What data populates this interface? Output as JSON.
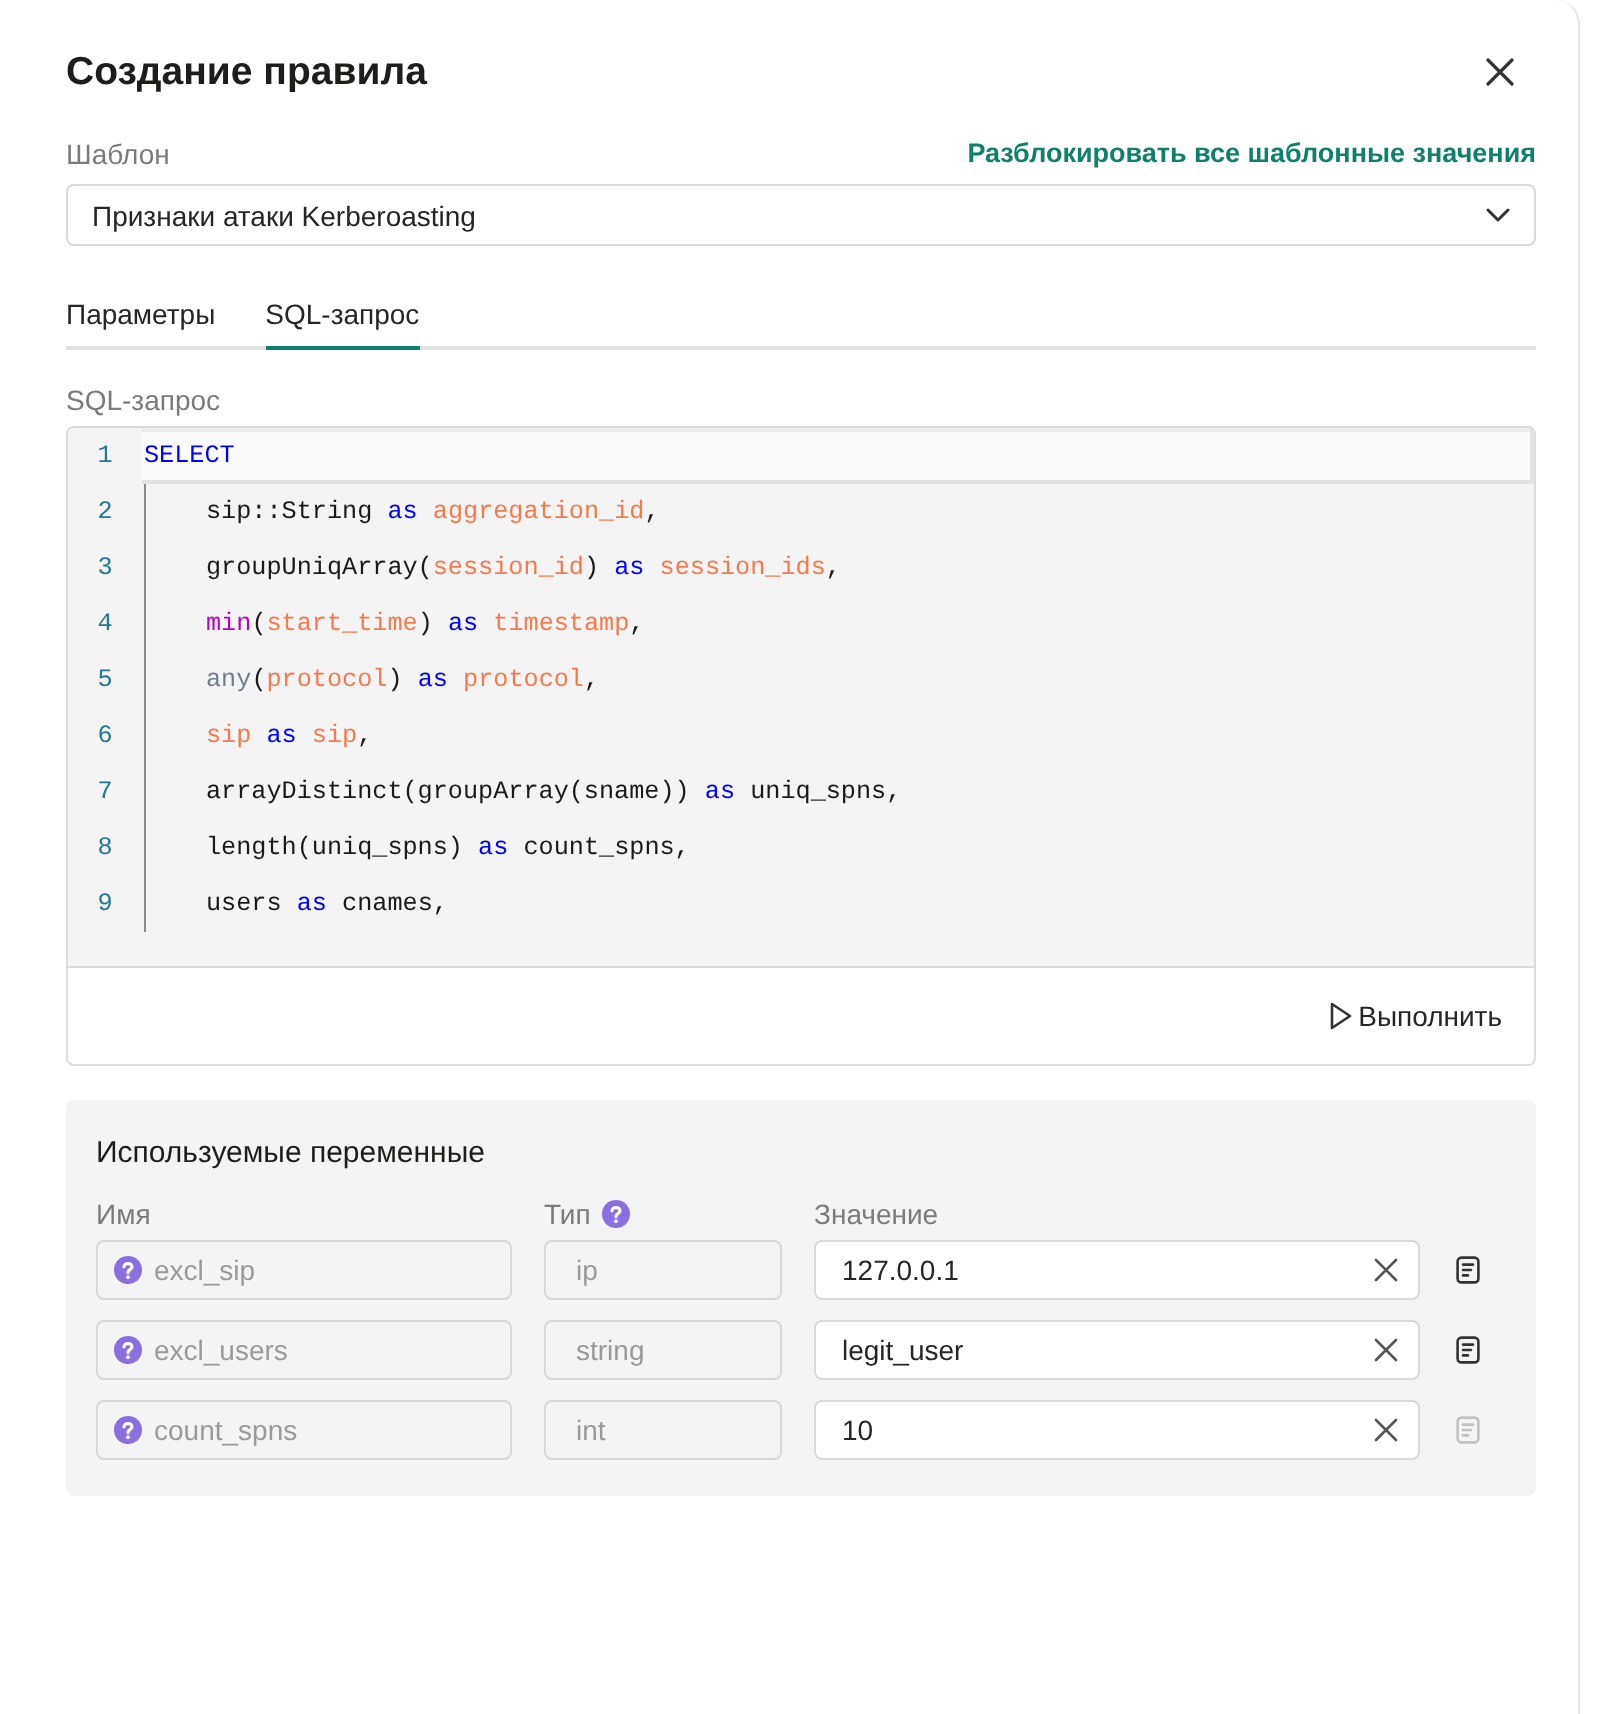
{
  "dialog": {
    "title": "Создание правила"
  },
  "template": {
    "label": "Шаблон",
    "unlock_link": "Разблокировать все шаблонные значения",
    "value": "Признаки атаки Kerberoasting"
  },
  "tabs": [
    {
      "label": "Параметры",
      "selected": false
    },
    {
      "label": "SQL-запрос",
      "selected": true
    }
  ],
  "sql_editor": {
    "label": "SQL-запрос",
    "lines": [
      {
        "number": "1",
        "active": true,
        "tokens": [
          {
            "kind": "keyword",
            "text": "SELECT"
          }
        ],
        "children": [
          {
            "number": "2",
            "active": false,
            "tokens": [
              {
                "kind": "plain",
                "text": "sip::String "
              },
              {
                "kind": "keyword",
                "text": "as "
              },
              {
                "kind": "identifier",
                "text": "aggregation_id"
              },
              {
                "kind": "plain",
                "text": ","
              }
            ]
          },
          {
            "number": "3",
            "active": false,
            "tokens": [
              {
                "kind": "plain",
                "text": "groupUniqArray("
              },
              {
                "kind": "identifier",
                "text": "session_id"
              },
              {
                "kind": "plain",
                "text": ") "
              },
              {
                "kind": "keyword",
                "text": "as "
              },
              {
                "kind": "identifier",
                "text": "session_ids"
              },
              {
                "kind": "plain",
                "text": ","
              }
            ]
          },
          {
            "number": "4",
            "active": false,
            "tokens": [
              {
                "kind": "function",
                "text": "min"
              },
              {
                "kind": "plain",
                "text": "("
              },
              {
                "kind": "identifier",
                "text": "start_time"
              },
              {
                "kind": "plain",
                "text": ") "
              },
              {
                "kind": "keyword",
                "text": "as "
              },
              {
                "kind": "identifier",
                "text": "timestamp"
              },
              {
                "kind": "plain",
                "text": ","
              }
            ]
          },
          {
            "number": "5",
            "active": false,
            "tokens": [
              {
                "kind": "builtin",
                "text": "any"
              },
              {
                "kind": "plain",
                "text": "("
              },
              {
                "kind": "identifier",
                "text": "protocol"
              },
              {
                "kind": "plain",
                "text": ") "
              },
              {
                "kind": "keyword",
                "text": "as "
              },
              {
                "kind": "identifier",
                "text": "protocol"
              },
              {
                "kind": "plain",
                "text": ","
              }
            ]
          },
          {
            "number": "6",
            "active": false,
            "tokens": [
              {
                "kind": "identifier",
                "text": "sip "
              },
              {
                "kind": "keyword",
                "text": "as "
              },
              {
                "kind": "identifier",
                "text": "sip"
              },
              {
                "kind": "plain",
                "text": ","
              }
            ]
          },
          {
            "number": "7",
            "active": false,
            "tokens": [
              {
                "kind": "plain",
                "text": "arrayDistinct(groupArray(sname)) "
              },
              {
                "kind": "keyword",
                "text": "as"
              },
              {
                "kind": "plain",
                "text": " uniq_spns,"
              }
            ]
          },
          {
            "number": "8",
            "active": false,
            "tokens": [
              {
                "kind": "plain",
                "text": "length(uniq_spns) "
              },
              {
                "kind": "keyword",
                "text": "as"
              },
              {
                "kind": "plain",
                "text": " count_spns,"
              }
            ]
          },
          {
            "number": "9",
            "active": false,
            "tokens": [
              {
                "kind": "plain",
                "text": "users "
              },
              {
                "kind": "keyword",
                "text": "as"
              },
              {
                "kind": "plain",
                "text": " cnames,"
              }
            ]
          }
        ]
      }
    ],
    "run_button": "Выполнить"
  },
  "variables": {
    "title": "Используемые переменные",
    "columns": [
      {
        "label": "Имя",
        "help": false
      },
      {
        "label": "Тип",
        "help": true
      },
      {
        "label": "Значение",
        "help": false
      }
    ],
    "rows": [
      {
        "name": "excl_sip",
        "type": "ip",
        "value": "127.0.0.1",
        "copy_disabled": false
      },
      {
        "name": "excl_users",
        "type": "string",
        "value": "legit_user",
        "copy_disabled": false
      },
      {
        "name": "count_spns",
        "type": "int",
        "value": "10",
        "copy_disabled": true
      }
    ]
  }
}
